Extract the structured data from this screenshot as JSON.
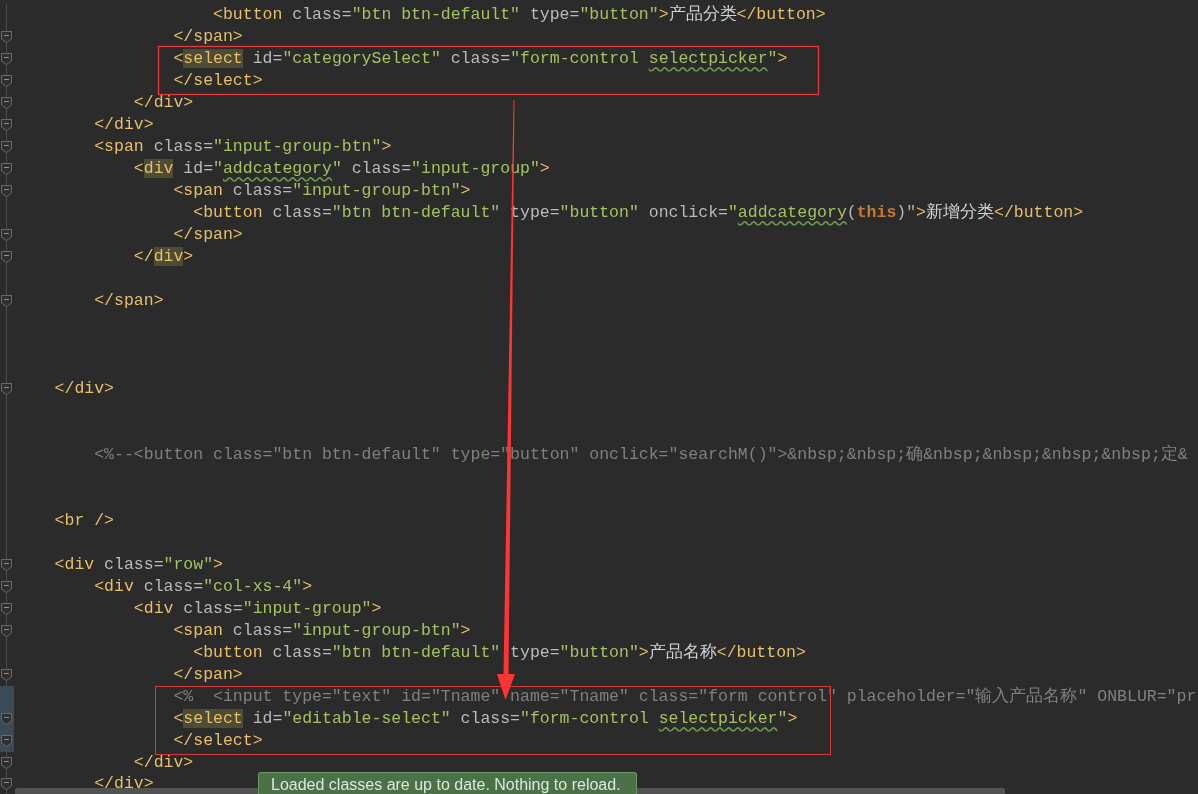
{
  "editor": {
    "lines": [
      {
        "kind": "code",
        "fold_marker": false,
        "changed": false,
        "tokens": [
          {
            "kind": "tag",
            "text": "                    <button"
          },
          {
            "kind": "attr",
            "text": " class="
          },
          {
            "kind": "value",
            "text": "\"btn btn-default\""
          },
          {
            "kind": "attr",
            "text": " type="
          },
          {
            "kind": "value",
            "text": "\"button\""
          },
          {
            "kind": "tag",
            "text": ">"
          },
          {
            "kind": "text",
            "text": "产品分类"
          },
          {
            "kind": "tag",
            "text": "</button>"
          }
        ]
      },
      {
        "kind": "code",
        "fold_marker": true,
        "changed": false,
        "tokens": [
          {
            "kind": "tag",
            "text": "                </span>"
          }
        ]
      },
      {
        "kind": "code",
        "fold_marker": true,
        "changed": false,
        "tokens": [
          {
            "kind": "tag",
            "text": "                <"
          },
          {
            "kind": "match",
            "text": "select"
          },
          {
            "kind": "attr",
            "text": " id="
          },
          {
            "kind": "value",
            "text": "\"categorySelect\""
          },
          {
            "kind": "attr",
            "text": " class="
          },
          {
            "kind": "value",
            "text": "\"form-control "
          },
          {
            "kind": "typo",
            "text": "selectpicker"
          },
          {
            "kind": "value",
            "text": "\""
          },
          {
            "kind": "tag",
            "text": ">"
          }
        ]
      },
      {
        "kind": "code",
        "fold_marker": true,
        "changed": false,
        "tokens": [
          {
            "kind": "tag",
            "text": "                </select>"
          }
        ]
      },
      {
        "kind": "code",
        "fold_marker": true,
        "changed": false,
        "tokens": [
          {
            "kind": "tag",
            "text": "            </div>"
          }
        ]
      },
      {
        "kind": "code",
        "fold_marker": true,
        "changed": false,
        "tokens": [
          {
            "kind": "tag",
            "text": "        </div>"
          }
        ]
      },
      {
        "kind": "code",
        "fold_marker": true,
        "changed": false,
        "tokens": [
          {
            "kind": "tag",
            "text": "        <span"
          },
          {
            "kind": "attr",
            "text": " class="
          },
          {
            "kind": "value",
            "text": "\"input-group-btn\""
          },
          {
            "kind": "tag",
            "text": ">"
          }
        ]
      },
      {
        "kind": "code",
        "fold_marker": true,
        "changed": false,
        "tokens": [
          {
            "kind": "tag",
            "text": "            <"
          },
          {
            "kind": "match",
            "text": "div"
          },
          {
            "kind": "attr",
            "text": " id="
          },
          {
            "kind": "value",
            "text": "\""
          },
          {
            "kind": "typo",
            "text": "addcategory"
          },
          {
            "kind": "value",
            "text": "\""
          },
          {
            "kind": "attr",
            "text": " class="
          },
          {
            "kind": "value",
            "text": "\"input-group\""
          },
          {
            "kind": "tag",
            "text": ">"
          }
        ]
      },
      {
        "kind": "code",
        "fold_marker": true,
        "changed": false,
        "tokens": [
          {
            "kind": "tag",
            "text": "                <span"
          },
          {
            "kind": "attr",
            "text": " class="
          },
          {
            "kind": "value",
            "text": "\"input-group-btn\""
          },
          {
            "kind": "tag",
            "text": ">"
          }
        ]
      },
      {
        "kind": "code",
        "fold_marker": false,
        "changed": false,
        "tokens": [
          {
            "kind": "tag",
            "text": "                  <button"
          },
          {
            "kind": "attr",
            "text": " class="
          },
          {
            "kind": "value",
            "text": "\"btn btn-default\""
          },
          {
            "kind": "attr",
            "text": " type="
          },
          {
            "kind": "value",
            "text": "\"button\""
          },
          {
            "kind": "attr",
            "text": " onclick="
          },
          {
            "kind": "value",
            "text": "\""
          },
          {
            "kind": "typo",
            "text": "addcategory"
          },
          {
            "kind": "plain",
            "text": "("
          },
          {
            "kind": "keyword",
            "text": "this"
          },
          {
            "kind": "plain",
            "text": ")"
          },
          {
            "kind": "value",
            "text": "\""
          },
          {
            "kind": "tag",
            "text": ">"
          },
          {
            "kind": "text",
            "text": "新增分类"
          },
          {
            "kind": "tag",
            "text": "</button>"
          }
        ]
      },
      {
        "kind": "code",
        "fold_marker": true,
        "changed": false,
        "tokens": [
          {
            "kind": "tag",
            "text": "                </span>"
          }
        ]
      },
      {
        "kind": "code",
        "fold_marker": true,
        "changed": false,
        "tokens": [
          {
            "kind": "tag",
            "text": "            </"
          },
          {
            "kind": "match",
            "text": "div"
          },
          {
            "kind": "tag",
            "text": ">"
          }
        ]
      },
      {
        "kind": "blank"
      },
      {
        "kind": "code",
        "fold_marker": true,
        "changed": false,
        "tokens": [
          {
            "kind": "tag",
            "text": "        </span>"
          }
        ]
      },
      {
        "kind": "blank"
      },
      {
        "kind": "blank"
      },
      {
        "kind": "blank"
      },
      {
        "kind": "code",
        "fold_marker": true,
        "changed": false,
        "tokens": [
          {
            "kind": "tag",
            "text": "    </div>"
          }
        ]
      },
      {
        "kind": "blank"
      },
      {
        "kind": "blank"
      },
      {
        "kind": "code",
        "fold_marker": false,
        "changed": false,
        "tokens": [
          {
            "kind": "comment",
            "text": "        <%--<button class=\"btn btn-default\" type=\"button\" onclick=\"searchM()\">&nbsp;&nbsp;确&nbsp;&nbsp;&nbsp;&nbsp;定&"
          }
        ]
      },
      {
        "kind": "blank"
      },
      {
        "kind": "blank"
      },
      {
        "kind": "code",
        "fold_marker": false,
        "changed": false,
        "tokens": [
          {
            "kind": "tag",
            "text": "    <br />"
          }
        ]
      },
      {
        "kind": "blank"
      },
      {
        "kind": "code",
        "fold_marker": true,
        "changed": false,
        "tokens": [
          {
            "kind": "tag",
            "text": "    <div"
          },
          {
            "kind": "attr",
            "text": " class="
          },
          {
            "kind": "value",
            "text": "\"row\""
          },
          {
            "kind": "tag",
            "text": ">"
          }
        ]
      },
      {
        "kind": "code",
        "fold_marker": true,
        "changed": false,
        "tokens": [
          {
            "kind": "tag",
            "text": "        <div"
          },
          {
            "kind": "attr",
            "text": " class="
          },
          {
            "kind": "value",
            "text": "\"col-xs-4\""
          },
          {
            "kind": "tag",
            "text": ">"
          }
        ]
      },
      {
        "kind": "code",
        "fold_marker": true,
        "changed": false,
        "tokens": [
          {
            "kind": "tag",
            "text": "            <div"
          },
          {
            "kind": "attr",
            "text": " class="
          },
          {
            "kind": "value",
            "text": "\"input-group\""
          },
          {
            "kind": "tag",
            "text": ">"
          }
        ]
      },
      {
        "kind": "code",
        "fold_marker": true,
        "changed": false,
        "tokens": [
          {
            "kind": "tag",
            "text": "                <span"
          },
          {
            "kind": "attr",
            "text": " class="
          },
          {
            "kind": "value",
            "text": "\"input-group-btn\""
          },
          {
            "kind": "tag",
            "text": ">"
          }
        ]
      },
      {
        "kind": "code",
        "fold_marker": false,
        "changed": false,
        "tokens": [
          {
            "kind": "tag",
            "text": "                  <button"
          },
          {
            "kind": "attr",
            "text": " class="
          },
          {
            "kind": "value",
            "text": "\"btn btn-default\""
          },
          {
            "kind": "attr",
            "text": " type="
          },
          {
            "kind": "value",
            "text": "\"button\""
          },
          {
            "kind": "tag",
            "text": ">"
          },
          {
            "kind": "text",
            "text": "产品名称"
          },
          {
            "kind": "tag",
            "text": "</button>"
          }
        ]
      },
      {
        "kind": "code",
        "fold_marker": true,
        "changed": false,
        "tokens": [
          {
            "kind": "tag",
            "text": "                </span>"
          }
        ]
      },
      {
        "kind": "code",
        "fold_marker": false,
        "changed": true,
        "tokens": [
          {
            "kind": "comment",
            "text": "                <%  <input type=\"text\" id=\"Tname\" name=\"Tname\" class=\"form control\" placeholder=\"输入产品名称\" ONBLUR=\"pr"
          }
        ]
      },
      {
        "kind": "code",
        "fold_marker": true,
        "changed": true,
        "tokens": [
          {
            "kind": "tag",
            "text": "                <"
          },
          {
            "kind": "match",
            "text": "select"
          },
          {
            "kind": "attr",
            "text": " id="
          },
          {
            "kind": "value",
            "text": "\"editable-select\""
          },
          {
            "kind": "attr",
            "text": " class="
          },
          {
            "kind": "value",
            "text": "\"form-control "
          },
          {
            "kind": "typo",
            "text": "selectpicker"
          },
          {
            "kind": "value",
            "text": "\""
          },
          {
            "kind": "tag",
            "text": ">"
          }
        ]
      },
      {
        "kind": "code",
        "fold_marker": true,
        "changed": true,
        "tokens": [
          {
            "kind": "tag",
            "text": "                </select>"
          }
        ]
      },
      {
        "kind": "code",
        "fold_marker": true,
        "changed": false,
        "tokens": [
          {
            "kind": "tag",
            "text": "            </div>"
          }
        ]
      },
      {
        "kind": "code",
        "fold_marker": true,
        "changed": false,
        "tokens": [
          {
            "kind": "tag",
            "text": "        </div>"
          }
        ]
      }
    ]
  },
  "notification": {
    "text": "Loaded classes are up to date. Nothing to reload."
  }
}
